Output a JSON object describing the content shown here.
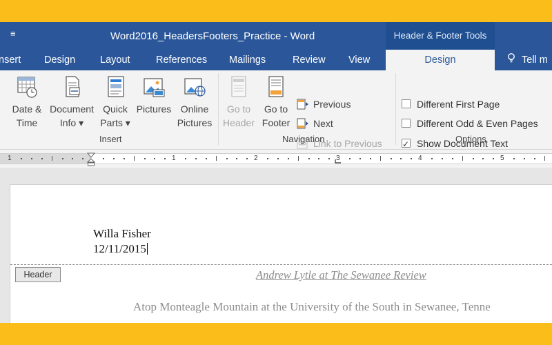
{
  "window": {
    "title": "Word2016_HeadersFooters_Practice - Word",
    "contextual_tools_label": "Header & Footer Tools",
    "quick_access_icon": "customize-quick-access-icon"
  },
  "tabs": [
    {
      "label": "nsert"
    },
    {
      "label": "Design"
    },
    {
      "label": "Layout"
    },
    {
      "label": "References"
    },
    {
      "label": "Mailings"
    },
    {
      "label": "Review"
    },
    {
      "label": "View"
    },
    {
      "label": "Design",
      "active": true
    },
    {
      "label": "Tell m"
    }
  ],
  "ribbon": {
    "insert": {
      "label": "Insert",
      "date_time": {
        "line1": "Date &",
        "line2": "Time"
      },
      "document_info": {
        "line1": "Document",
        "line2": "Info ▾"
      },
      "quick_parts": {
        "line1": "Quick",
        "line2": "Parts ▾"
      },
      "pictures": {
        "line1": "Pictures"
      },
      "online_pictures": {
        "line1": "Online",
        "line2": "Pictures"
      }
    },
    "navigation": {
      "label": "Navigation",
      "go_to_header": {
        "line1": "Go to",
        "line2": "Header"
      },
      "go_to_footer": {
        "line1": "Go to",
        "line2": "Footer"
      },
      "previous": "Previous",
      "next": "Next",
      "link_to_previous": "Link to Previous"
    },
    "options": {
      "label": "Options",
      "different_first_page": {
        "label": "Different First Page",
        "checked": false
      },
      "different_odd_even": {
        "label": "Different Odd & Even Pages",
        "checked": false
      },
      "show_document_text": {
        "label": "Show Document Text",
        "checked": true
      }
    }
  },
  "ruler": {
    "numbers": [
      "1",
      "1",
      "2",
      "3",
      "4",
      "5"
    ]
  },
  "document": {
    "header_line1": "Willa Fisher",
    "header_line2": "12/11/2015",
    "header_tag": "Header",
    "running_head": "Andrew Lytle at The Sewanee Review",
    "body_text": "Atop Monteagle Mountain at the University of the South in Sewanee, Tenne"
  },
  "colors": {
    "accent": "#2b579a",
    "border_frame": "#fbbd1a",
    "contextual_tab": "#1f4e91"
  }
}
